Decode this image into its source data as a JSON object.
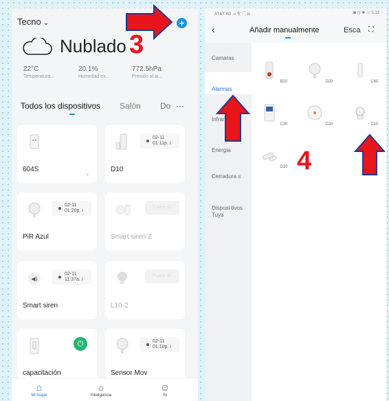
{
  "left": {
    "home_name": "Tecno",
    "weather": "Nublado",
    "stats": [
      {
        "value": "22°C",
        "label": "Temperatura..."
      },
      {
        "value": "20.1%",
        "label": "Humedad ex..."
      },
      {
        "value": "772.5hPa",
        "label": "Presión al ai..."
      }
    ],
    "tabs": [
      "Todos los dispositivos",
      "Salón",
      "Do",
      "···"
    ],
    "devices": [
      {
        "name": "604S"
      },
      {
        "name": "D10",
        "time": "02-11",
        "time2": "01:11p. i"
      },
      {
        "name": "PiR Azul",
        "time": "02-11",
        "time2": "01:20p. i"
      },
      {
        "name": "Smart siren 2",
        "status": "Fuera de"
      },
      {
        "name": "Smart siren",
        "time": "02-11",
        "time2": "11:37a. i"
      },
      {
        "name": "L10-2",
        "status": "Fuera de"
      },
      {
        "name": "capacitación"
      },
      {
        "name": "Sensor Mov",
        "time": "02-11",
        "time2": "01:10p. i"
      }
    ],
    "nav": [
      "Mi hogar",
      "Inteligencia",
      "Yo"
    ]
  },
  "right": {
    "status_left": "AT&T 4G .ıl 令 ▢ ◘",
    "status_right": "◙ ◷ ✱ ▭ 5:13",
    "title": "Añadir manualmente",
    "esc": "Esca",
    "sidebar": [
      "Camaras",
      "Alarmas",
      "Infrarrojo",
      "Energia",
      "Cerradura s",
      "Disposi tivos Tuya"
    ],
    "devices": [
      "B20",
      "D20",
      "C60",
      "C30",
      "C20",
      "C10",
      "D10"
    ]
  },
  "annotations": {
    "step3": "3",
    "step4": "4"
  },
  "colors": {
    "accent": "#1a93e0",
    "arrow": "#e8151b",
    "arrow_border": "#1f3a93",
    "power": "#22b573"
  }
}
